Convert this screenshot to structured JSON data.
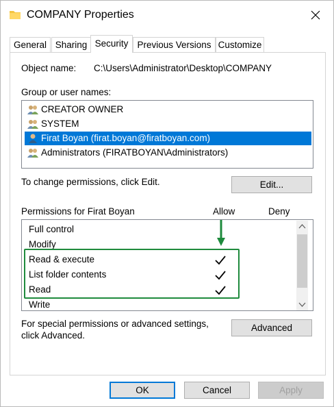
{
  "window": {
    "title": "COMPANY Properties",
    "folder_icon": "folder-icon",
    "close_icon": "close-icon"
  },
  "tabs": [
    {
      "label": "General",
      "active": false
    },
    {
      "label": "Sharing",
      "active": false
    },
    {
      "label": "Security",
      "active": true
    },
    {
      "label": "Previous Versions",
      "active": false
    },
    {
      "label": "Customize",
      "active": false
    }
  ],
  "security": {
    "object_name_label": "Object name:",
    "object_name_value": "C:\\Users\\Administrator\\Desktop\\COMPANY",
    "group_label": "Group or user names:",
    "users": [
      {
        "name": "CREATOR OWNER",
        "icon": "group-icon",
        "selected": false
      },
      {
        "name": "SYSTEM",
        "icon": "group-icon",
        "selected": false
      },
      {
        "name": "Firat Boyan (firat.boyan@firatboyan.com)",
        "icon": "user-icon",
        "selected": true
      },
      {
        "name": "Administrators (FIRATBOYAN\\Administrators)",
        "icon": "group-icon",
        "selected": false
      }
    ],
    "change_hint": "To change permissions, click Edit.",
    "edit_button": "Edit...",
    "permissions_label": "Permissions for Firat Boyan",
    "allow_header": "Allow",
    "deny_header": "Deny",
    "permissions": [
      {
        "name": "Full control",
        "allow": false,
        "deny": false
      },
      {
        "name": "Modify",
        "allow": false,
        "deny": false
      },
      {
        "name": "Read & execute",
        "allow": true,
        "deny": false
      },
      {
        "name": "List folder contents",
        "allow": true,
        "deny": false
      },
      {
        "name": "Read",
        "allow": true,
        "deny": false
      },
      {
        "name": "Write",
        "allow": false,
        "deny": false
      }
    ],
    "special_hint_line1": "For special permissions or advanced settings,",
    "special_hint_line2": "click Advanced.",
    "advanced_button": "Advanced",
    "annotation_color": "#1e8a3c"
  },
  "footer": {
    "ok_button": "OK",
    "cancel_button": "Cancel",
    "apply_button": "Apply",
    "apply_enabled": false
  }
}
